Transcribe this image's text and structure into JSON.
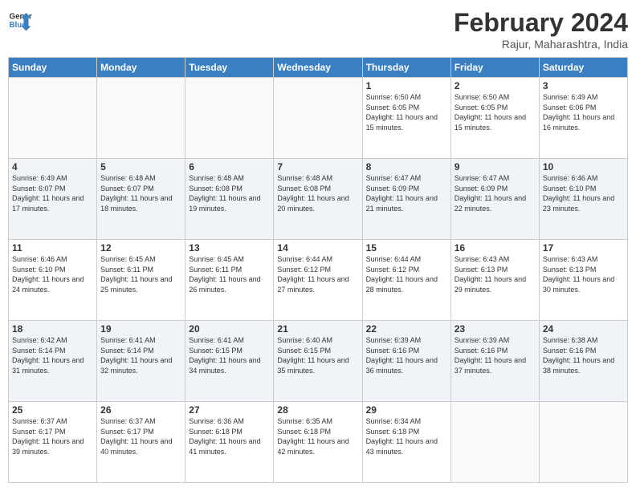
{
  "header": {
    "logo_line1": "General",
    "logo_line2": "Blue",
    "month_title": "February 2024",
    "location": "Rajur, Maharashtra, India"
  },
  "days_of_week": [
    "Sunday",
    "Monday",
    "Tuesday",
    "Wednesday",
    "Thursday",
    "Friday",
    "Saturday"
  ],
  "weeks": [
    {
      "alt": false,
      "days": [
        {
          "num": "",
          "info": ""
        },
        {
          "num": "",
          "info": ""
        },
        {
          "num": "",
          "info": ""
        },
        {
          "num": "",
          "info": ""
        },
        {
          "num": "1",
          "info": "Sunrise: 6:50 AM\nSunset: 6:05 PM\nDaylight: 11 hours and 15 minutes."
        },
        {
          "num": "2",
          "info": "Sunrise: 6:50 AM\nSunset: 6:05 PM\nDaylight: 11 hours and 15 minutes."
        },
        {
          "num": "3",
          "info": "Sunrise: 6:49 AM\nSunset: 6:06 PM\nDaylight: 11 hours and 16 minutes."
        }
      ]
    },
    {
      "alt": true,
      "days": [
        {
          "num": "4",
          "info": "Sunrise: 6:49 AM\nSunset: 6:07 PM\nDaylight: 11 hours and 17 minutes."
        },
        {
          "num": "5",
          "info": "Sunrise: 6:48 AM\nSunset: 6:07 PM\nDaylight: 11 hours and 18 minutes."
        },
        {
          "num": "6",
          "info": "Sunrise: 6:48 AM\nSunset: 6:08 PM\nDaylight: 11 hours and 19 minutes."
        },
        {
          "num": "7",
          "info": "Sunrise: 6:48 AM\nSunset: 6:08 PM\nDaylight: 11 hours and 20 minutes."
        },
        {
          "num": "8",
          "info": "Sunrise: 6:47 AM\nSunset: 6:09 PM\nDaylight: 11 hours and 21 minutes."
        },
        {
          "num": "9",
          "info": "Sunrise: 6:47 AM\nSunset: 6:09 PM\nDaylight: 11 hours and 22 minutes."
        },
        {
          "num": "10",
          "info": "Sunrise: 6:46 AM\nSunset: 6:10 PM\nDaylight: 11 hours and 23 minutes."
        }
      ]
    },
    {
      "alt": false,
      "days": [
        {
          "num": "11",
          "info": "Sunrise: 6:46 AM\nSunset: 6:10 PM\nDaylight: 11 hours and 24 minutes."
        },
        {
          "num": "12",
          "info": "Sunrise: 6:45 AM\nSunset: 6:11 PM\nDaylight: 11 hours and 25 minutes."
        },
        {
          "num": "13",
          "info": "Sunrise: 6:45 AM\nSunset: 6:11 PM\nDaylight: 11 hours and 26 minutes."
        },
        {
          "num": "14",
          "info": "Sunrise: 6:44 AM\nSunset: 6:12 PM\nDaylight: 11 hours and 27 minutes."
        },
        {
          "num": "15",
          "info": "Sunrise: 6:44 AM\nSunset: 6:12 PM\nDaylight: 11 hours and 28 minutes."
        },
        {
          "num": "16",
          "info": "Sunrise: 6:43 AM\nSunset: 6:13 PM\nDaylight: 11 hours and 29 minutes."
        },
        {
          "num": "17",
          "info": "Sunrise: 6:43 AM\nSunset: 6:13 PM\nDaylight: 11 hours and 30 minutes."
        }
      ]
    },
    {
      "alt": true,
      "days": [
        {
          "num": "18",
          "info": "Sunrise: 6:42 AM\nSunset: 6:14 PM\nDaylight: 11 hours and 31 minutes."
        },
        {
          "num": "19",
          "info": "Sunrise: 6:41 AM\nSunset: 6:14 PM\nDaylight: 11 hours and 32 minutes."
        },
        {
          "num": "20",
          "info": "Sunrise: 6:41 AM\nSunset: 6:15 PM\nDaylight: 11 hours and 34 minutes."
        },
        {
          "num": "21",
          "info": "Sunrise: 6:40 AM\nSunset: 6:15 PM\nDaylight: 11 hours and 35 minutes."
        },
        {
          "num": "22",
          "info": "Sunrise: 6:39 AM\nSunset: 6:16 PM\nDaylight: 11 hours and 36 minutes."
        },
        {
          "num": "23",
          "info": "Sunrise: 6:39 AM\nSunset: 6:16 PM\nDaylight: 11 hours and 37 minutes."
        },
        {
          "num": "24",
          "info": "Sunrise: 6:38 AM\nSunset: 6:16 PM\nDaylight: 11 hours and 38 minutes."
        }
      ]
    },
    {
      "alt": false,
      "days": [
        {
          "num": "25",
          "info": "Sunrise: 6:37 AM\nSunset: 6:17 PM\nDaylight: 11 hours and 39 minutes."
        },
        {
          "num": "26",
          "info": "Sunrise: 6:37 AM\nSunset: 6:17 PM\nDaylight: 11 hours and 40 minutes."
        },
        {
          "num": "27",
          "info": "Sunrise: 6:36 AM\nSunset: 6:18 PM\nDaylight: 11 hours and 41 minutes."
        },
        {
          "num": "28",
          "info": "Sunrise: 6:35 AM\nSunset: 6:18 PM\nDaylight: 11 hours and 42 minutes."
        },
        {
          "num": "29",
          "info": "Sunrise: 6:34 AM\nSunset: 6:18 PM\nDaylight: 11 hours and 43 minutes."
        },
        {
          "num": "",
          "info": ""
        },
        {
          "num": "",
          "info": ""
        }
      ]
    }
  ]
}
